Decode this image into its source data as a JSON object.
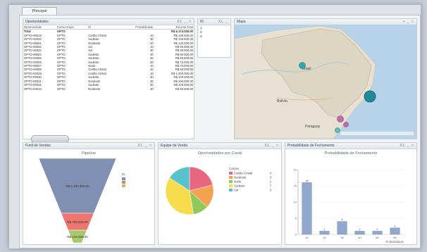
{
  "tab": {
    "label": "Principal"
  },
  "oportunidades": {
    "title": "Oportunidades",
    "icons": "XL _ □",
    "columns": [
      "Oportunidade",
      "Conta Grupo",
      "ID",
      "Probabilidade",
      "Receita Total"
    ],
    "total": [
      "Total",
      "OPTO",
      "",
      "",
      "R$ 6.174.000,00"
    ],
    "rows": [
      [
        "OPTO-00019",
        "OPTO",
        "Cartão Cristal",
        "10",
        "R$ 130.000,00"
      ],
      [
        "OPTO-00020",
        "OPTO",
        "Sudeste",
        "30",
        "R$ 130.000,00"
      ],
      [
        "OPTO-00021",
        "OPTO",
        "Nordeste",
        "20",
        "R$ 130.000,00"
      ],
      [
        "OPTO-00022",
        "OPTO",
        "Sul",
        "10",
        "R$ 90.000,00"
      ],
      [
        "OPTO-00023",
        "OPTO",
        "Sul",
        "30",
        "R$ 90.000,00"
      ],
      [
        "OPTO-00024",
        "OPTO",
        "Sudeste",
        "30",
        "R$ 80.000,00"
      ],
      [
        "OPTO-00025",
        "OPTO",
        "Sudeste",
        "30",
        "R$ 80.000,00"
      ],
      [
        "OPTO-00026",
        "OPTO",
        "Sudeste",
        "30",
        "R$ 70.000,00"
      ],
      [
        "OPTO-00027",
        "OPTO",
        "Norte",
        "10",
        "R$ 70.000,00"
      ],
      [
        "OPTO-00028",
        "OPTO",
        "Cartão Cristal",
        "10",
        "R$ 60.000,00"
      ],
      [
        "OPTO-00029",
        "OPTO",
        "Cartão Cristal",
        "10",
        "R$ 1.000.000,00"
      ],
      [
        "OPTO-00030",
        "OPTO",
        "Sudeste",
        "30",
        "R$ 100.000,00"
      ],
      [
        "OPTO-00031",
        "OPTO",
        "Nordeste",
        "30",
        "R$ 100.000,00"
      ],
      [
        "OPTO-00032",
        "OPTO",
        "Sudeste",
        "30",
        "R$ 100.000,00"
      ],
      [
        "OPTO-00033",
        "OPTO",
        "Nordeste",
        "30",
        "R$ 90.000,00"
      ]
    ]
  },
  "filter": {
    "title": "ID",
    "icons": "XL _",
    "items": [
      "1",
      "2",
      "3"
    ]
  },
  "mapa": {
    "title": "Mapa",
    "icons": "+ _ □",
    "labels": [
      "Brasil",
      "Bolivia",
      "Paraguay"
    ]
  },
  "funil": {
    "title": "Funil de Vendas",
    "icons": "XL _ □",
    "chart_title": "Pipeline",
    "legend_title": "ID",
    "stages": [
      {
        "label": "R$ 5.200.000,00",
        "color": "#7f90b3"
      },
      {
        "label": "R$ 700.000,00",
        "color": "#ee7570"
      },
      {
        "label": "R$ 170.000,00",
        "color": "#a8c96c"
      }
    ]
  },
  "equipe": {
    "title": "Equipe de Venda",
    "icons": "XL _ □"
  },
  "pizza": {
    "chart_title": "Oportunidades por Canal",
    "legend_title": "Canais",
    "slices": [
      {
        "name": "Cartão Cristal",
        "value": 4,
        "color": "#e8677e"
      },
      {
        "name": "Nordeste",
        "value": 3,
        "color": "#f5a250"
      },
      {
        "name": "Norte",
        "value": 2,
        "color": "#8fc95b"
      },
      {
        "name": "Sudeste",
        "value": 7,
        "color": "#f7dc4d"
      },
      {
        "name": "Sul",
        "value": 3,
        "color": "#58c2cc"
      }
    ]
  },
  "prob": {
    "title": "Probabilidade de Fechamento",
    "icons": "XL _ □",
    "chart_title": "Probabilidade de Fechamento",
    "xlabel": "Probabilidade",
    "bar_color": "#90a8cc"
  },
  "chart_data": {
    "type": "bar",
    "title": "Probabilidade de Fechamento",
    "categories": [
      "10",
      "20",
      "30",
      "40",
      "50",
      "60"
    ],
    "values": [
      16,
      1,
      4,
      1,
      1,
      2
    ],
    "xlabel": "Probabilidade",
    "ylabel": "",
    "ylim": [
      0,
      20
    ],
    "yticks": [
      0,
      5,
      10,
      15,
      20
    ],
    "data_labels": [
      "16",
      "1",
      "4",
      "1",
      "1",
      "2"
    ]
  }
}
